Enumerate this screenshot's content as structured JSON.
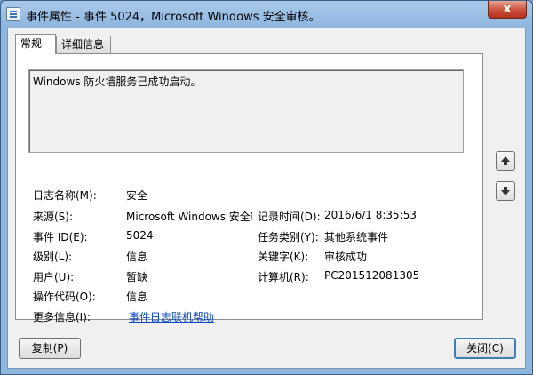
{
  "window": {
    "title": "事件属性 - 事件 5024，Microsoft Windows 安全审核。",
    "close_label": "x"
  },
  "tabs": [
    {
      "label": "常规",
      "active": true
    },
    {
      "label": "详细信息",
      "active": false
    }
  ],
  "description": "Windows 防火墙服务已成功启动。",
  "fields": {
    "log_name": {
      "label": "日志名称(M):",
      "value": "安全"
    },
    "source": {
      "label": "来源(S):",
      "value": "Microsoft Windows 安全审"
    },
    "logged": {
      "label": "记录时间(D):",
      "value": "2016/6/1 8:35:53"
    },
    "event_id": {
      "label": "事件 ID(E):",
      "value": "5024"
    },
    "task_category": {
      "label": "任务类别(Y):",
      "value": "其他系统事件"
    },
    "level": {
      "label": "级别(L):",
      "value": "信息"
    },
    "keywords": {
      "label": "关键字(K):",
      "value": "审核成功"
    },
    "user": {
      "label": "用户(U):",
      "value": "暂缺"
    },
    "computer": {
      "label": "计算机(R):",
      "value": "PC201512081305"
    },
    "opcode": {
      "label": "操作代码(O):",
      "value": "信息"
    },
    "more_info": {
      "label": "更多信息(I):",
      "value": "事件日志联机帮助"
    }
  },
  "buttons": {
    "copy": "复制(P)",
    "close": "关闭(C)"
  },
  "icons": {
    "up": "arrow-up-icon",
    "down": "arrow-down-icon"
  }
}
